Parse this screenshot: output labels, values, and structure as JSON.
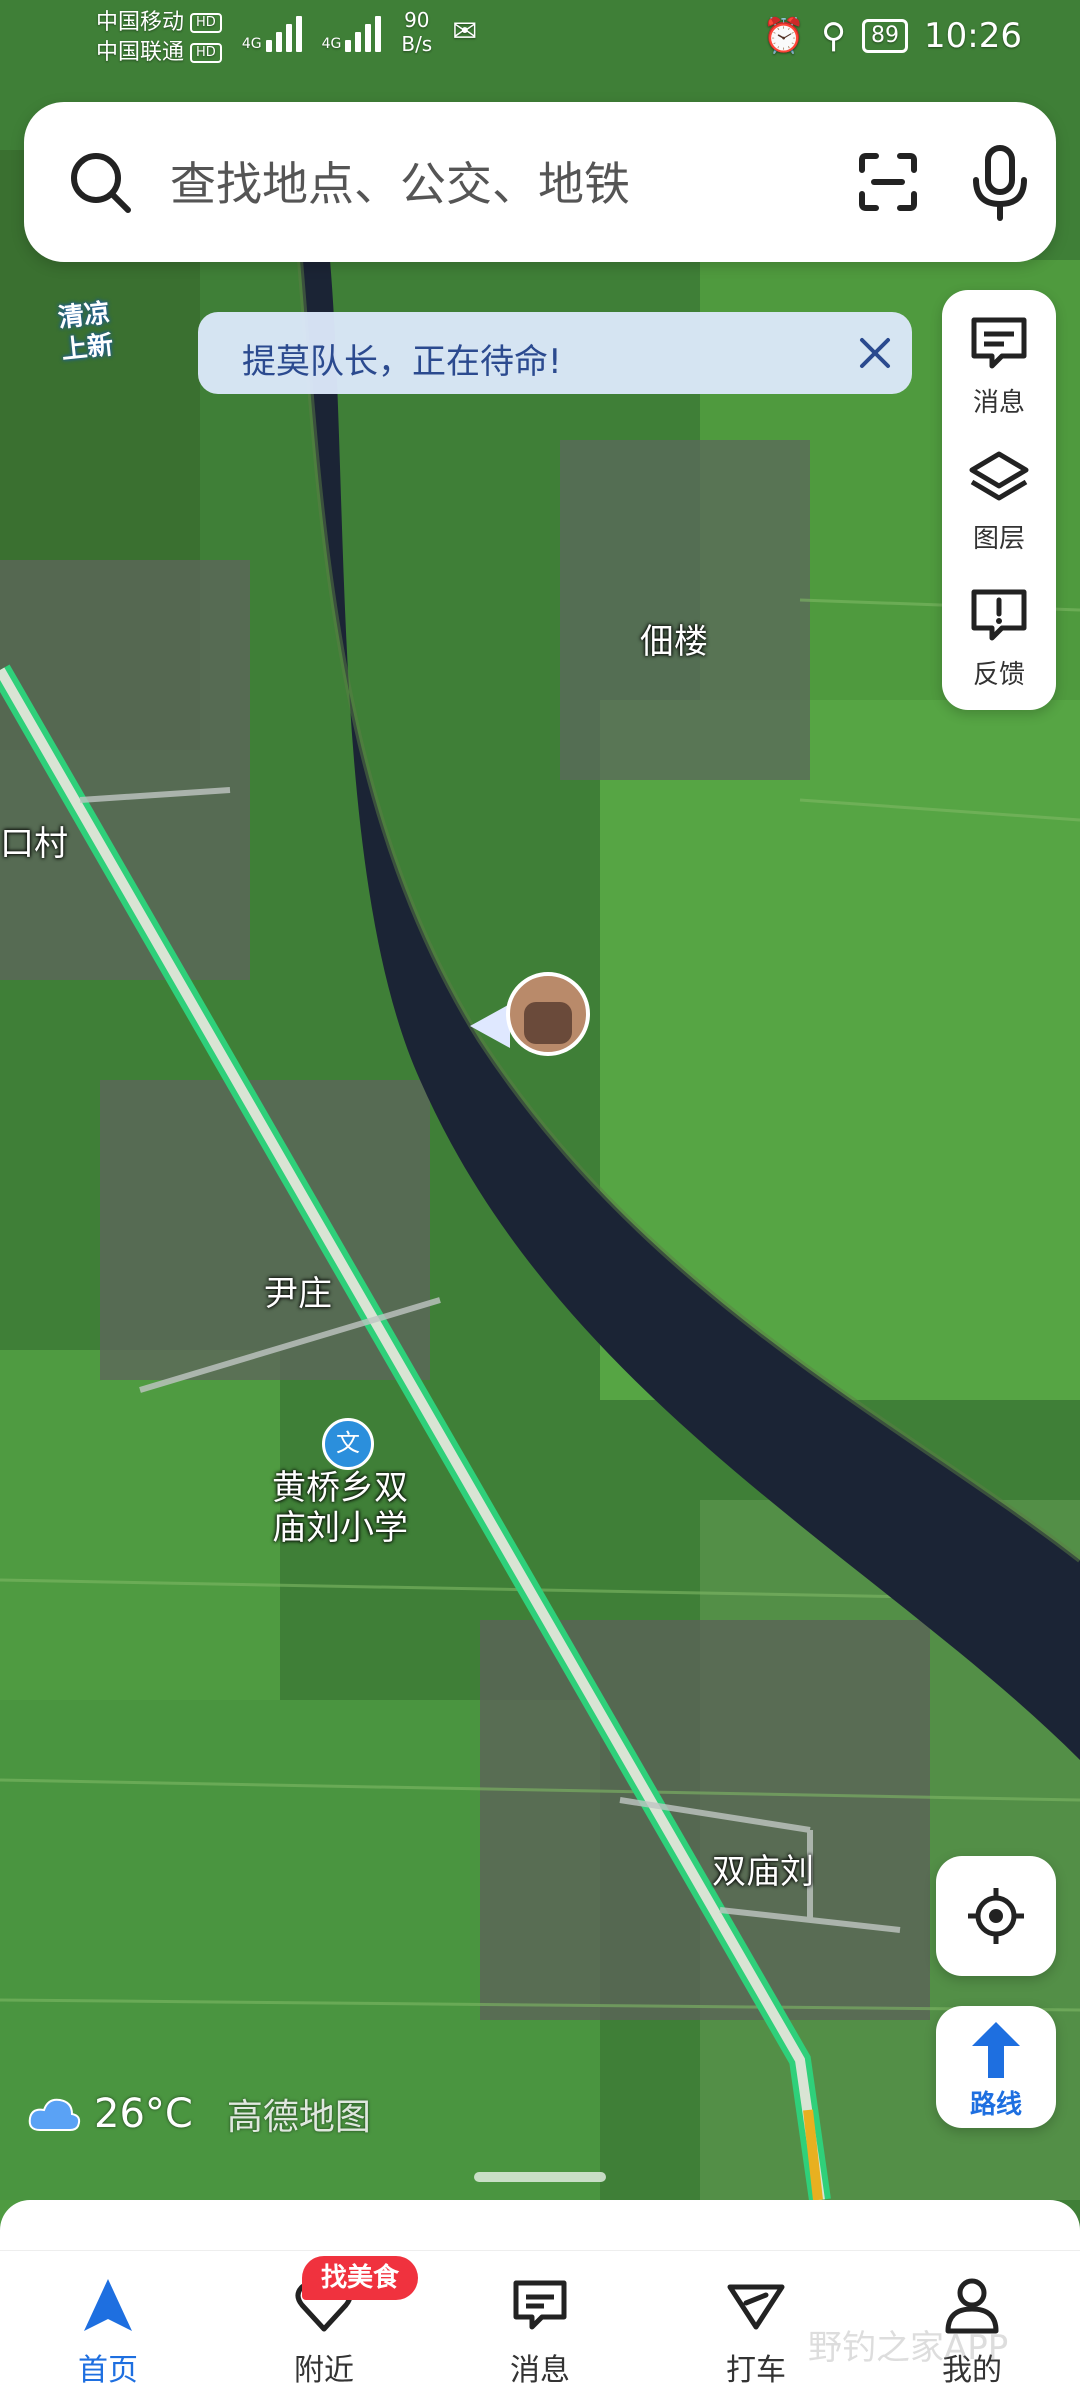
{
  "status_bar": {
    "carrier1": "中国移动",
    "carrier2": "中国联通",
    "hd": "HD",
    "net_type1": "4G",
    "net_type2": "4G",
    "net_speed_value": "90",
    "net_speed_unit": "B/s",
    "battery": "89",
    "time": "10:26"
  },
  "search": {
    "placeholder": "查找地点、公交、地铁"
  },
  "promo_badge": {
    "line1": "清凉",
    "line2": "上新"
  },
  "notice": {
    "text": "提莫队长，正在待命!"
  },
  "side_panel": {
    "messages": "消息",
    "layers": "图层",
    "feedback": "反馈"
  },
  "map_labels": {
    "village1": "佃楼",
    "village2": "口村",
    "village3": "尹庄",
    "school_line1": "黄桥乡双",
    "school_line2": "庙刘小学",
    "village4": "双庙刘",
    "school_marker": "文"
  },
  "route_button": {
    "label": "路线"
  },
  "weather": {
    "temp": "26°C",
    "brand": "高德地图"
  },
  "bottom_nav": {
    "home": "首页",
    "nearby": "附近",
    "messages": "消息",
    "taxi": "打车",
    "mine": "我的",
    "food_badge": "找美食"
  },
  "watermark": "野钓之家APP",
  "colors": {
    "accent": "#1e6fe0",
    "badge": "#f0323e",
    "road": "#2fd07a"
  }
}
